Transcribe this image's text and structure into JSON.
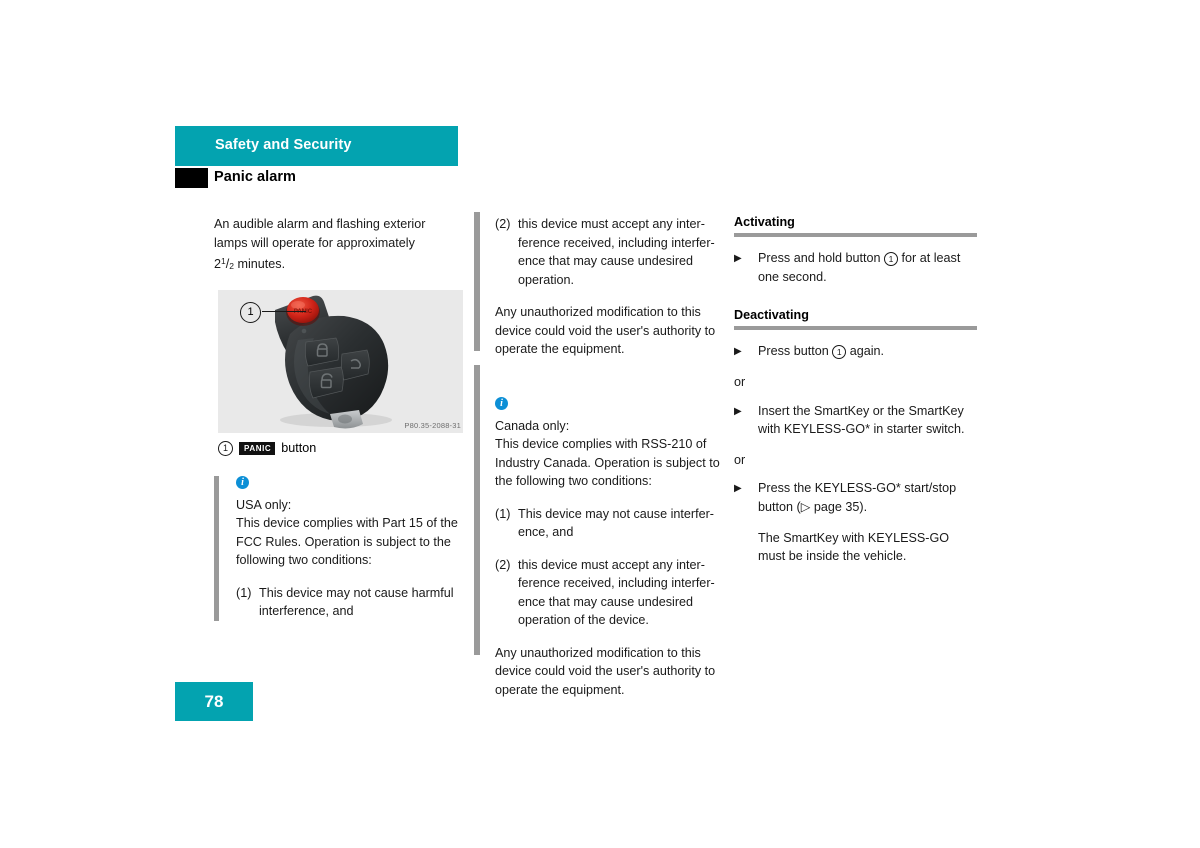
{
  "header": {
    "chapter": "Safety and Security",
    "section": "Panic alarm"
  },
  "column1": {
    "intro_line1": "An audible alarm and flashing exterior",
    "intro_line2": "lamps will operate for approximately",
    "intro_value_whole": "2",
    "intro_value_num": "1",
    "intro_value_den": "2",
    "intro_value_unit": " minutes.",
    "figure": {
      "callout_number": "1",
      "image_id": "P80.35-2088-31",
      "alt": "Mercedes SmartKey remote with panic button"
    },
    "legend": {
      "number": "1",
      "badge": "PANIC",
      "label": "button"
    },
    "infobox": {
      "icon": "info-icon",
      "heading": "USA only:",
      "body": "This device complies with Part 15 of the FCC Rules. Operation is subject to the following two conditions:",
      "conditions": [
        {
          "num": "(1)",
          "text": "This device may not cause harmful interference, and"
        }
      ]
    }
  },
  "column2": {
    "conditions_cont": [
      {
        "num": "(2)",
        "text": "this device must accept any inter-ference received, including interfer-ence that may cause undesired operation."
      }
    ],
    "disclaimer": "Any unauthorized modification to this device could void the user's authority to operate the equipment.",
    "infobox": {
      "icon": "info-icon",
      "heading": "Canada only:",
      "body": "This device complies with RSS-210 of Industry Canada. Operation is subject to the following two conditions:",
      "conditions": [
        {
          "num": "(1)",
          "text": "This device may not cause interfer-ence, and"
        },
        {
          "num": "(2)",
          "text": "this device must accept any inter-ference received, including interfer-ence that may cause undesired operation of the device."
        }
      ],
      "disclaimer": "Any unauthorized modification to this device could void the user's authority to operate the equipment."
    }
  },
  "column3": {
    "activating": {
      "heading": "Activating",
      "steps": [
        {
          "bullet": "▶",
          "pre": "Press and hold button ",
          "circle": "1",
          "post": " for at least one second."
        }
      ]
    },
    "deactivating": {
      "heading": "Deactivating",
      "steps": [
        {
          "bullet": "▶",
          "pre": "Press button ",
          "circle": "1",
          "post": " again."
        }
      ],
      "or_1": "or",
      "step_2": {
        "bullet": "▶",
        "text": "Insert the SmartKey or the SmartKey with KEYLESS-GO* in starter switch."
      },
      "or_2": "or",
      "step_3": {
        "bullet": "▶",
        "pre": "Press the KEYLESS-GO* start/stop button (",
        "ref_icon": "▷",
        "ref": " page 35).",
        "post": ""
      },
      "note": "The SmartKey with KEYLESS-GO must be inside the vehicle."
    }
  },
  "footer": {
    "page_number": "78"
  },
  "colors": {
    "accent_teal": "#03a3b0",
    "info_blue": "#0c8fd6",
    "rule_gray": "#9a9a9a",
    "figure_bg": "#e9e9e9"
  }
}
